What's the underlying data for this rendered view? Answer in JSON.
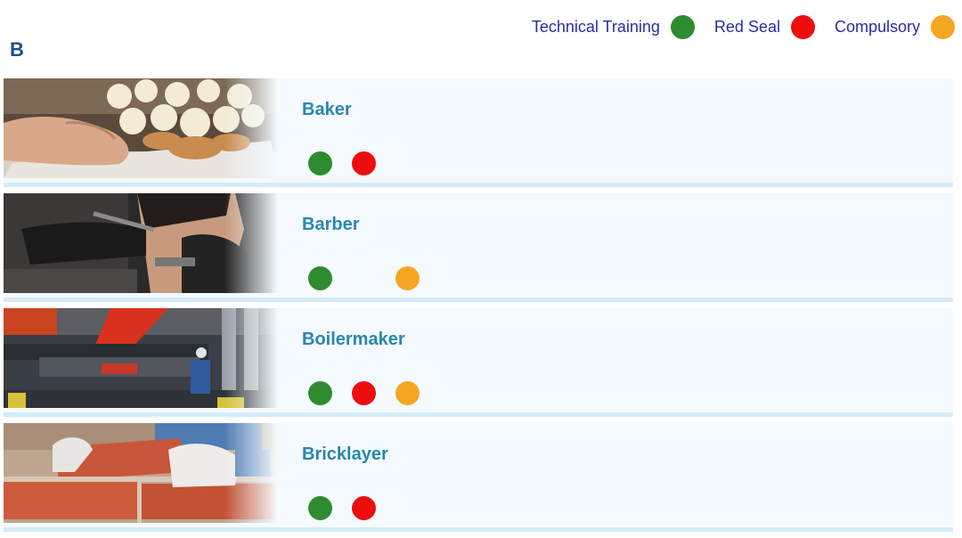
{
  "legend": {
    "items": [
      {
        "label": "Technical Training",
        "color": "#2e8b30",
        "key": "technical"
      },
      {
        "label": "Red Seal",
        "color": "#ee0d0d",
        "key": "redseal"
      },
      {
        "label": "Compulsory",
        "color": "#f5a623",
        "key": "compulsory"
      }
    ]
  },
  "section": {
    "letter": "B"
  },
  "trades": [
    {
      "name": "Baker",
      "technical": true,
      "redseal": true,
      "compulsory": false,
      "photo": "baker-photo"
    },
    {
      "name": "Barber",
      "technical": true,
      "redseal": false,
      "compulsory": true,
      "photo": "barber-photo"
    },
    {
      "name": "Boilermaker",
      "technical": true,
      "redseal": true,
      "compulsory": true,
      "photo": "boilermaker-photo"
    },
    {
      "name": "Bricklayer",
      "technical": true,
      "redseal": true,
      "compulsory": false,
      "photo": "bricklayer-photo"
    }
  ]
}
